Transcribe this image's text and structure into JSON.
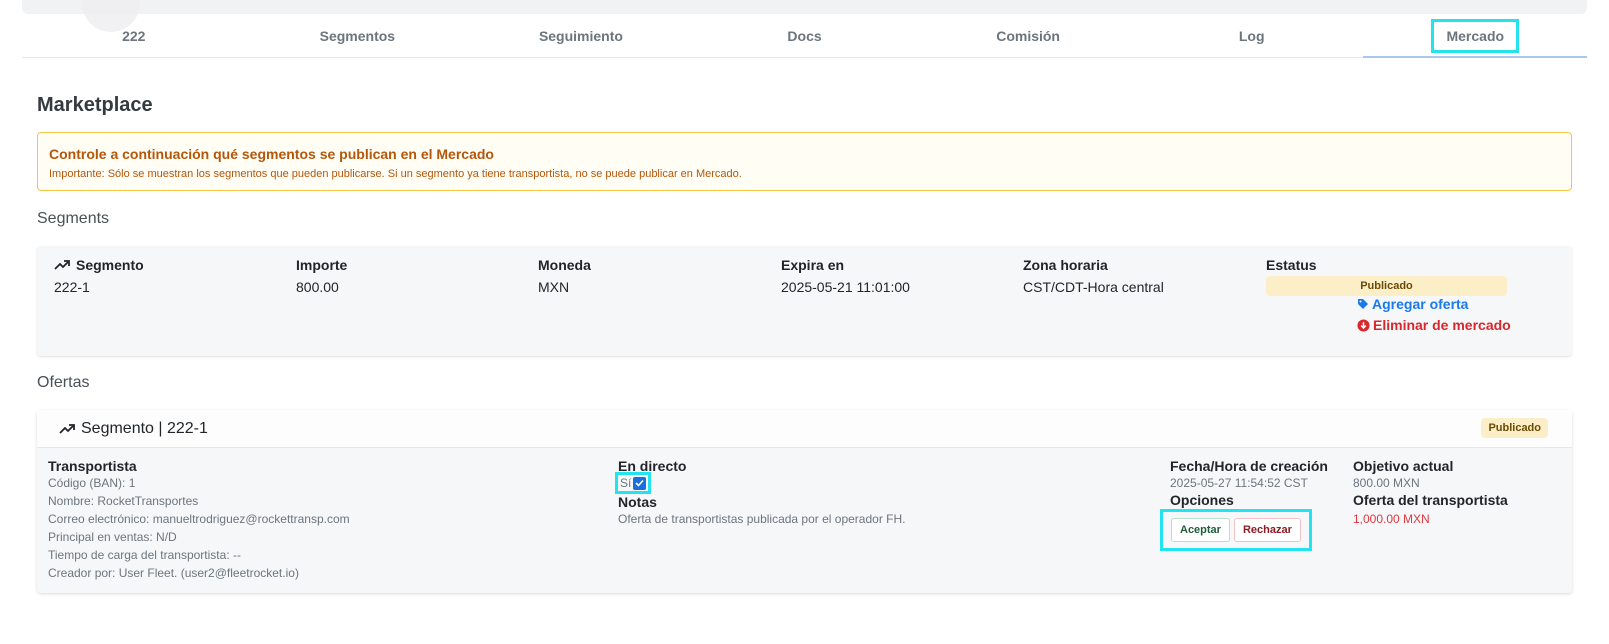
{
  "tabs": [
    {
      "label": "222"
    },
    {
      "label": "Segmentos"
    },
    {
      "label": "Seguimiento"
    },
    {
      "label": "Docs"
    },
    {
      "label": "Comisión"
    },
    {
      "label": "Log"
    },
    {
      "label": "Mercado",
      "active": true
    }
  ],
  "page": {
    "title": "Marketplace"
  },
  "alert": {
    "title": "Controle a continuación qué segmentos se publican en el Mercado",
    "text": "Importante: Sólo se muestran los segmentos que pueden publicarse. Si un segmento ya tiene transportista, no se puede publicar en Mercado."
  },
  "segments": {
    "section_title": "Segments",
    "headers": {
      "segment": "Segmento",
      "amount": "Importe",
      "currency": "Moneda",
      "expires": "Expira en",
      "timezone": "Zona horaria",
      "status": "Estatus"
    },
    "row": {
      "segment": "222-1",
      "amount": "800.00",
      "currency": "MXN",
      "expires": "2025-05-21 11:01:00",
      "timezone": "CST/CDT-Hora central",
      "status": "Publicado"
    },
    "actions": {
      "add_offer": "Agregar oferta",
      "remove": "Eliminar de mercado"
    }
  },
  "offers": {
    "section_title": "Ofertas",
    "card": {
      "title": "Segmento | 222-1",
      "status": "Publicado",
      "carrier": {
        "title": "Transportista",
        "code": "Código (BAN): 1",
        "name": "Nombre: RocketTransportes",
        "email": "Correo electrónico: manueltrodriguez@rockettransp.com",
        "sales": "Principal en ventas: N/D",
        "load_time": "Tiempo de carga del transportista: --",
        "creator": "Creador por: User Fleet. (user2@fleetrocket.io)"
      },
      "direct": {
        "title": "En directo",
        "value": "Sí",
        "checked": true
      },
      "notes": {
        "title": "Notas",
        "text": "Oferta de transportistas publicada por el operador FH."
      },
      "created": {
        "title": "Fecha/Hora de creación",
        "value": "2025-05-27 11:54:52 CST"
      },
      "options": {
        "title": "Opciones",
        "accept": "Aceptar",
        "reject": "Rechazar"
      },
      "target": {
        "title": "Objetivo actual",
        "value": "800.00 MXN"
      },
      "carrier_offer": {
        "title": "Oferta del transportista",
        "value": "1,000.00 MXN"
      }
    }
  },
  "colors": {
    "highlight": "#22e3ee",
    "link_blue": "#1a7ae8",
    "link_red": "#d9272e",
    "alert_text": "#b4570a",
    "badge_bg": "#fcefc8"
  }
}
